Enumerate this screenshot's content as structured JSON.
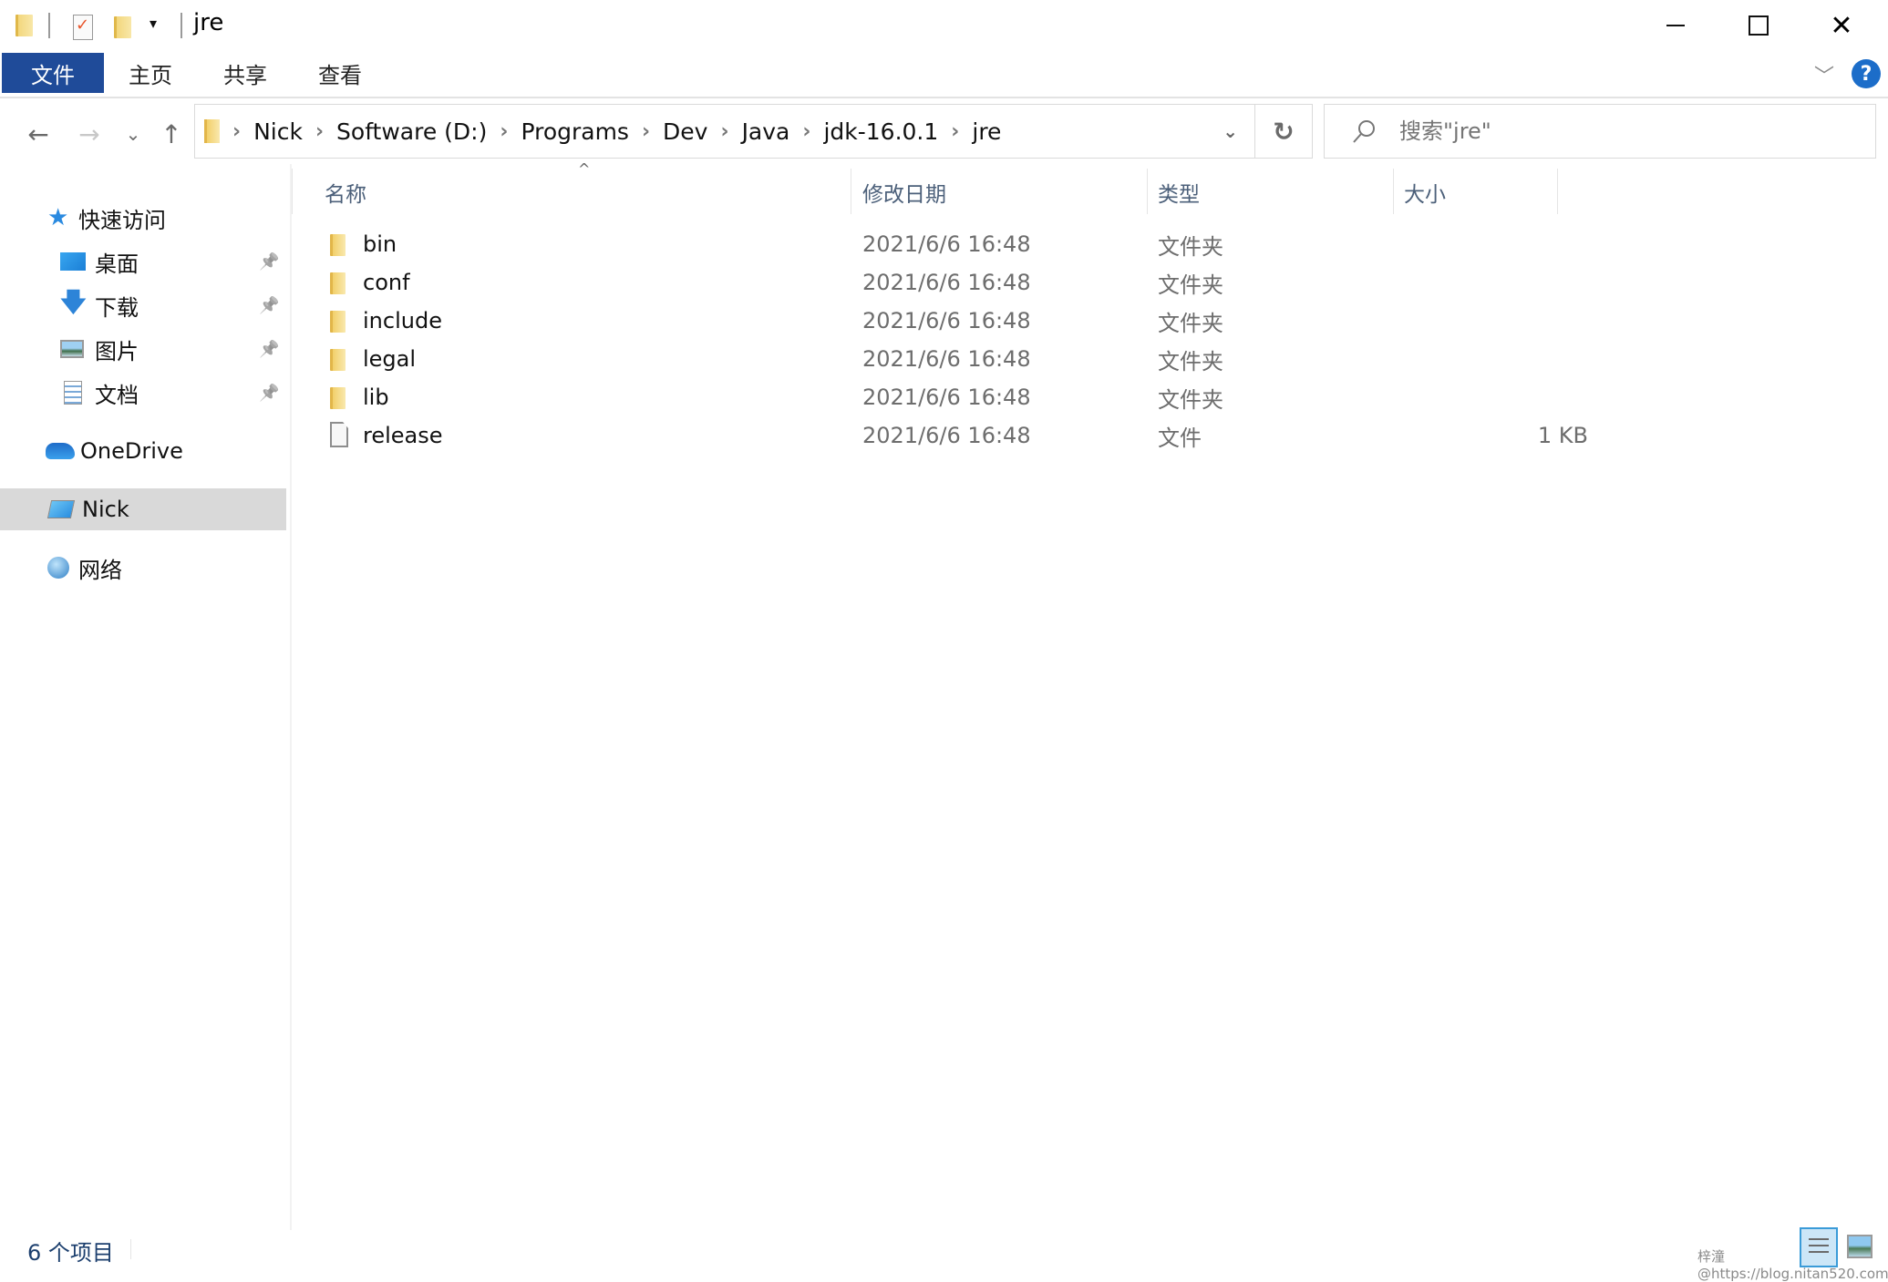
{
  "window": {
    "title": "jre",
    "minimize_icon": "minimize-icon",
    "maximize_icon": "maximize-icon",
    "close_icon": "close-icon"
  },
  "quick_access_toolbar": {
    "icons": [
      "folder-icon",
      "properties-check-icon",
      "new-folder-icon",
      "customize-dropdown-icon"
    ]
  },
  "ribbon": {
    "tabs": [
      {
        "label": "文件",
        "active": true
      },
      {
        "label": "主页"
      },
      {
        "label": "共享"
      },
      {
        "label": "查看"
      }
    ],
    "expand_icon": "chevron-down-icon",
    "help_label": "?",
    "accent_color": "#1f4b99"
  },
  "navigation": {
    "back_icon": "←",
    "forward_icon": "→",
    "recent_icon": "⌄",
    "up_icon": "↑",
    "breadcrumb": [
      "Nick",
      "Software (D:)",
      "Programs",
      "Dev",
      "Java",
      "jdk-16.0.1",
      "jre"
    ],
    "separator": "›",
    "history_dropdown_icon": "chevron-down-icon",
    "refresh_icon": "↻",
    "search_placeholder": "搜索\"jre\""
  },
  "sidebar": {
    "quick_access": {
      "label": "快速访问",
      "icon": "star-icon"
    },
    "pinned": [
      {
        "label": "桌面",
        "icon": "desktop-icon"
      },
      {
        "label": "下载",
        "icon": "download-icon"
      },
      {
        "label": "图片",
        "icon": "pictures-icon"
      },
      {
        "label": "文档",
        "icon": "documents-icon"
      }
    ],
    "pin_glyph": "📌",
    "onedrive": {
      "label": "OneDrive",
      "icon": "cloud-icon"
    },
    "this_pc": {
      "label": "Nick",
      "icon": "computer-icon",
      "selected": true
    },
    "network": {
      "label": "网络",
      "icon": "network-icon"
    }
  },
  "file_list": {
    "sort_indicator": "^",
    "columns": [
      "名称",
      "修改日期",
      "类型",
      "大小"
    ],
    "rows": [
      {
        "name": "bin",
        "date": "2021/6/6 16:48",
        "type": "文件夹",
        "size": "",
        "kind": "folder"
      },
      {
        "name": "conf",
        "date": "2021/6/6 16:48",
        "type": "文件夹",
        "size": "",
        "kind": "folder"
      },
      {
        "name": "include",
        "date": "2021/6/6 16:48",
        "type": "文件夹",
        "size": "",
        "kind": "folder"
      },
      {
        "name": "legal",
        "date": "2021/6/6 16:48",
        "type": "文件夹",
        "size": "",
        "kind": "folder"
      },
      {
        "name": "lib",
        "date": "2021/6/6 16:48",
        "type": "文件夹",
        "size": "",
        "kind": "folder"
      },
      {
        "name": "release",
        "date": "2021/6/6 16:48",
        "type": "文件",
        "size": "1 KB",
        "kind": "file"
      }
    ]
  },
  "status_bar": {
    "item_count": "6 个项目",
    "watermark": "梓潼@https://blog.nitan520.com"
  }
}
